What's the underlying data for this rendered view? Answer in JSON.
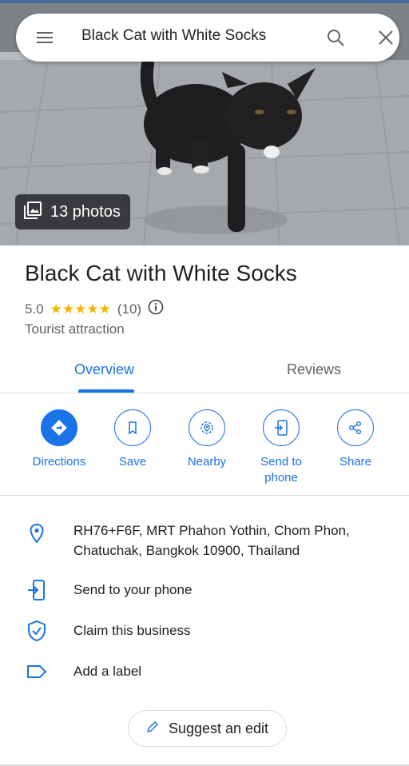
{
  "search": {
    "query": "Black Cat with White Socks",
    "menu_icon": "menu-icon",
    "search_icon": "search-icon",
    "clear_icon": "close-icon"
  },
  "hero": {
    "photos_label": "13 photos",
    "photos_icon": "photo-library-icon"
  },
  "place": {
    "title": "Black Cat with White Socks",
    "rating": "5.0",
    "stars": "★★★★★",
    "review_count": "(10)",
    "info_icon": "info-icon",
    "category": "Tourist attraction"
  },
  "tabs": [
    {
      "label": "Overview",
      "active": true
    },
    {
      "label": "Reviews",
      "active": false
    }
  ],
  "actions": [
    {
      "label": "Directions",
      "icon": "directions-icon"
    },
    {
      "label": "Save",
      "icon": "bookmark-icon"
    },
    {
      "label": "Nearby",
      "icon": "nearby-icon"
    },
    {
      "label": "Send to phone",
      "icon": "send-to-phone-icon"
    },
    {
      "label": "Share",
      "icon": "share-icon"
    }
  ],
  "details": {
    "address_line1": "RH76+F6F, MRT Phahon Yothin, Chom Phon,",
    "address_line2": "Chatuchak, Bangkok 10900, Thailand",
    "send_to_phone": "Send to your phone",
    "claim_business": "Claim this business",
    "add_label": "Add a label"
  },
  "suggest_edit": "Suggest an edit",
  "colors": {
    "accent": "#1a73e8",
    "star": "#f4b400",
    "text_primary": "#202124",
    "text_secondary": "#5f6368",
    "divider": "#dadce0"
  }
}
